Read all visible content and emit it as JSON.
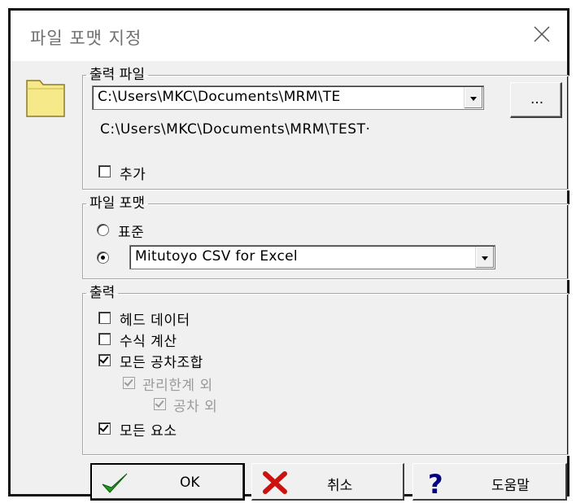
{
  "window": {
    "title": "파일 포맷 지정"
  },
  "output_file": {
    "legend": "출력 파일",
    "combo_value": "C:\\Users\\MKC\\Documents\\MRM\\TE",
    "browse_label": "...",
    "path_display": "C:\\Users\\MKC\\Documents\\MRM\\TEST·",
    "append": {
      "label": "추가",
      "checked": false
    }
  },
  "file_format": {
    "legend": "파일 포맷",
    "standard": {
      "label": "표준",
      "selected": false
    },
    "custom": {
      "selected": true,
      "combo_value": "Mitutoyo CSV for Excel"
    }
  },
  "output": {
    "legend": "출력",
    "items": [
      {
        "label": "헤드 데이터",
        "checked": false,
        "enabled": true
      },
      {
        "label": "수식 계산",
        "checked": false,
        "enabled": true
      },
      {
        "label": "모든 공차조합",
        "checked": true,
        "enabled": true
      },
      {
        "label": "관리한계 외",
        "checked": true,
        "enabled": false
      },
      {
        "label": "공차 외",
        "checked": true,
        "enabled": false
      },
      {
        "label": "모든 요소",
        "checked": true,
        "enabled": true
      }
    ]
  },
  "buttons": {
    "ok": {
      "label": "OK",
      "icon": "green-check-icon"
    },
    "cancel": {
      "label": "취소",
      "icon": "red-x-icon"
    },
    "help": {
      "label": "도움말",
      "icon": "question-mark-icon"
    }
  },
  "colors": {
    "check_green": "#1f9a1f",
    "cancel_red": "#cc1111",
    "help_blue": "#000080",
    "folder_yellow": "#f6e98a"
  }
}
